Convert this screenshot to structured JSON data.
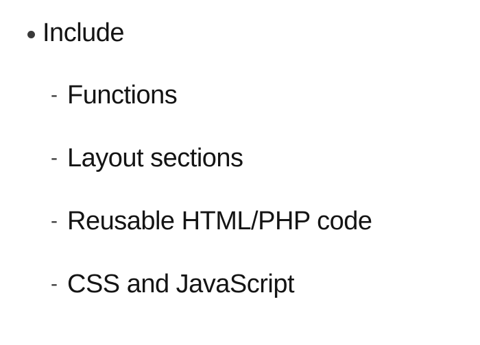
{
  "slide": {
    "heading": "Include",
    "bullet_icon": "bullet-dot-icon",
    "dash": "-",
    "items": [
      {
        "text": "Functions"
      },
      {
        "text": "Layout sections"
      },
      {
        "text": "Reusable HTML/PHP code"
      },
      {
        "text": "CSS and JavaScript"
      }
    ]
  },
  "colors": {
    "background": "#ffffff",
    "text": "#141414",
    "bullet": "#3a3a3a"
  }
}
